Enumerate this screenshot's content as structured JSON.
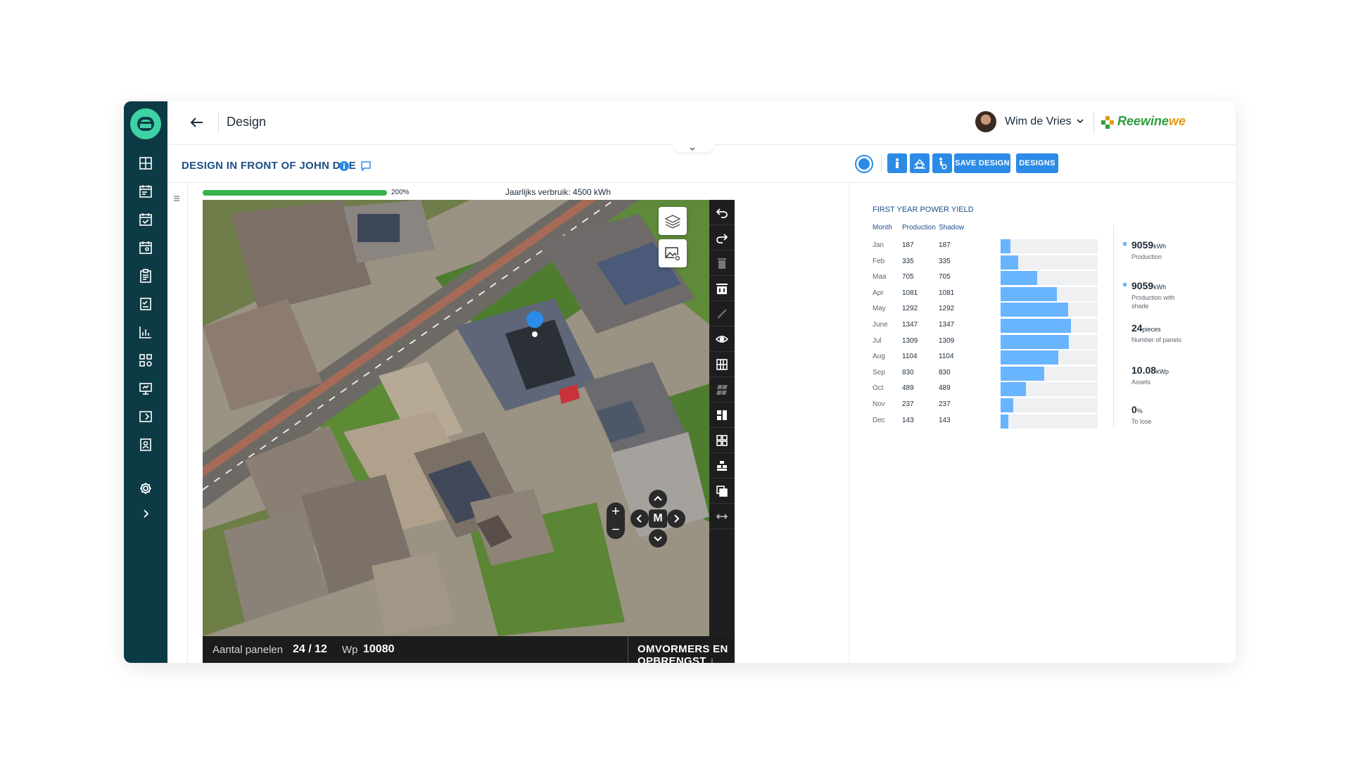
{
  "header": {
    "title": "Design",
    "user_name": "Wim de Vries",
    "brand_name_green": "Reewine",
    "brand_name_orange": "we"
  },
  "subheader": {
    "design_title": "DESIGN IN FRONT OF JOHN DOE",
    "save_label": "SAVE DESIGN",
    "designs_label": "DESIGNS"
  },
  "map_status": {
    "progress_label": "200%",
    "progress_fraction": 1.0,
    "usage_label": "Jaarlijks verbruik: 4500 kWh"
  },
  "map_nav": {
    "center_label": "M",
    "zoom_in": "+",
    "zoom_out": "−"
  },
  "bottom_bar": {
    "panels_label": "Aantal panelen",
    "panels_value": "24 / 12",
    "wp_label": "Wp",
    "wp_value": "10080",
    "action_label": "OMVORMERS EN OPBRENGST"
  },
  "yield": {
    "title": "FIRST YEAR POWER YIELD",
    "columns": [
      "Month",
      "Production",
      "Shadow"
    ],
    "rows": [
      {
        "month": "Jan",
        "production": "187",
        "shadow": "187"
      },
      {
        "month": "Feb",
        "production": "335",
        "shadow": "335"
      },
      {
        "month": "Maa",
        "production": "705",
        "shadow": "705"
      },
      {
        "month": "Apr",
        "production": "1081",
        "shadow": "1081"
      },
      {
        "month": "May",
        "production": "1292",
        "shadow": "1292"
      },
      {
        "month": "June",
        "production": "1347",
        "shadow": "1347"
      },
      {
        "month": "Jul",
        "production": "1309",
        "shadow": "1309"
      },
      {
        "month": "Aug",
        "production": "1104",
        "shadow": "1104"
      },
      {
        "month": "Sep",
        "production": "830",
        "shadow": "830"
      },
      {
        "month": "Oct",
        "production": "489",
        "shadow": "489"
      },
      {
        "month": "Nov",
        "production": "237",
        "shadow": "237"
      },
      {
        "month": "Dec",
        "production": "143",
        "shadow": "143"
      }
    ],
    "bar_max": 1860,
    "stats": [
      {
        "value": "9059",
        "unit": "kWh",
        "label": "Production",
        "dot": true
      },
      {
        "value": "9059",
        "unit": "kWh",
        "label": "Production with shade",
        "dot": true
      },
      {
        "value": "24",
        "unit": "pieces",
        "label": "Number of panels",
        "dot": false
      },
      {
        "value": "10.08",
        "unit": "kWp",
        "label": "Assets",
        "dot": false
      },
      {
        "value": "0",
        "unit": "%",
        "label": "To lose",
        "dot": false
      }
    ]
  },
  "colors": {
    "sidebar": "#0d3b45",
    "accent": "#2b8be6",
    "bar": "#69b4ff",
    "progress": "#37b34a",
    "title_blue": "#1c4e87"
  }
}
